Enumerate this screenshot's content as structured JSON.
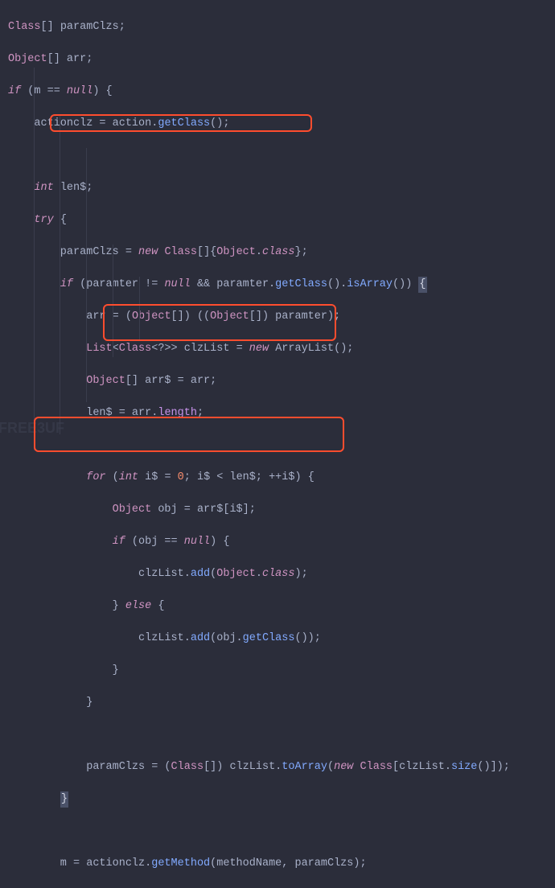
{
  "code": {
    "l1": {
      "a": "Class",
      "b": "[] paramClzs;"
    },
    "l2": {
      "a": "Object",
      "b": "[] arr;"
    },
    "l3": {
      "a": "if",
      "b": " (m == ",
      "c": "null",
      "d": ") {"
    },
    "l4": {
      "a": "    actionclz = action.",
      "b": "getClass",
      "c": "();"
    },
    "l5": "",
    "l6": {
      "a": "    ",
      "b": "int",
      "c": " len$;"
    },
    "l7": {
      "a": "    ",
      "b": "try",
      "c": " {"
    },
    "l8": {
      "a": "        paramClzs = ",
      "b": "new",
      "c": " ",
      "d": "Class",
      "e": "[]{",
      "f": "Object",
      "g": ".",
      "h": "class",
      "i": "};"
    },
    "l9": {
      "a": "        ",
      "b": "if",
      "c": " (paramter != ",
      "d": "null",
      "e": " && paramter.",
      "f": "getClass",
      "g": "().",
      "h": "isArray",
      "i": "()) ",
      "j": "{"
    },
    "l10": {
      "a": "            arr = (",
      "b": "Object",
      "c": "[]) ((",
      "d": "Object",
      "e": "[]) paramter);"
    },
    "l11": {
      "a": "            ",
      "b": "List",
      "c": "<",
      "d": "Class",
      "e": "<?>> clzList = ",
      "f": "new",
      "g": " ArrayList();"
    },
    "l12": {
      "a": "            ",
      "b": "Object",
      "c": "[] arr$ = arr;"
    },
    "l13": {
      "a": "            len$ = arr.",
      "b": "length",
      "c": ";"
    },
    "l14": "",
    "l15": {
      "a": "            ",
      "b": "for",
      "c": " (",
      "d": "int",
      "e": " i$ = ",
      "f": "0",
      "g": "; i$ < len$; ++i$) {"
    },
    "l16": {
      "a": "                ",
      "b": "Object",
      "c": " obj = arr$[i$];"
    },
    "l17": {
      "a": "                ",
      "b": "if",
      "c": " (obj == ",
      "d": "null",
      "e": ") {"
    },
    "l18": {
      "a": "                    clzList.",
      "b": "add",
      "c": "(",
      "d": "Object",
      "e": ".",
      "f": "class",
      "g": ");"
    },
    "l19": {
      "a": "                } ",
      "b": "else",
      "c": " {"
    },
    "l20": {
      "a": "                    clzList.",
      "b": "add",
      "c": "(obj.",
      "d": "getClass",
      "e": "());"
    },
    "l21": {
      "a": "                }"
    },
    "l22": {
      "a": "            }"
    },
    "l23": "",
    "l24": {
      "a": "            paramClzs = (",
      "b": "Class",
      "c": "[]) clzList.",
      "d": "toArray",
      "e": "(",
      "f": "new",
      "g": " ",
      "h": "Class",
      "i": "[clzList.",
      "j": "size",
      "k": "()]);"
    },
    "l25": {
      "a": "        ",
      "b": "}"
    },
    "l26": "",
    "l27": {
      "a": "        m = actionclz.",
      "b": "getMethod",
      "c": "(methodName, paramClzs);"
    }
  },
  "watermark": "FREE3UF"
}
